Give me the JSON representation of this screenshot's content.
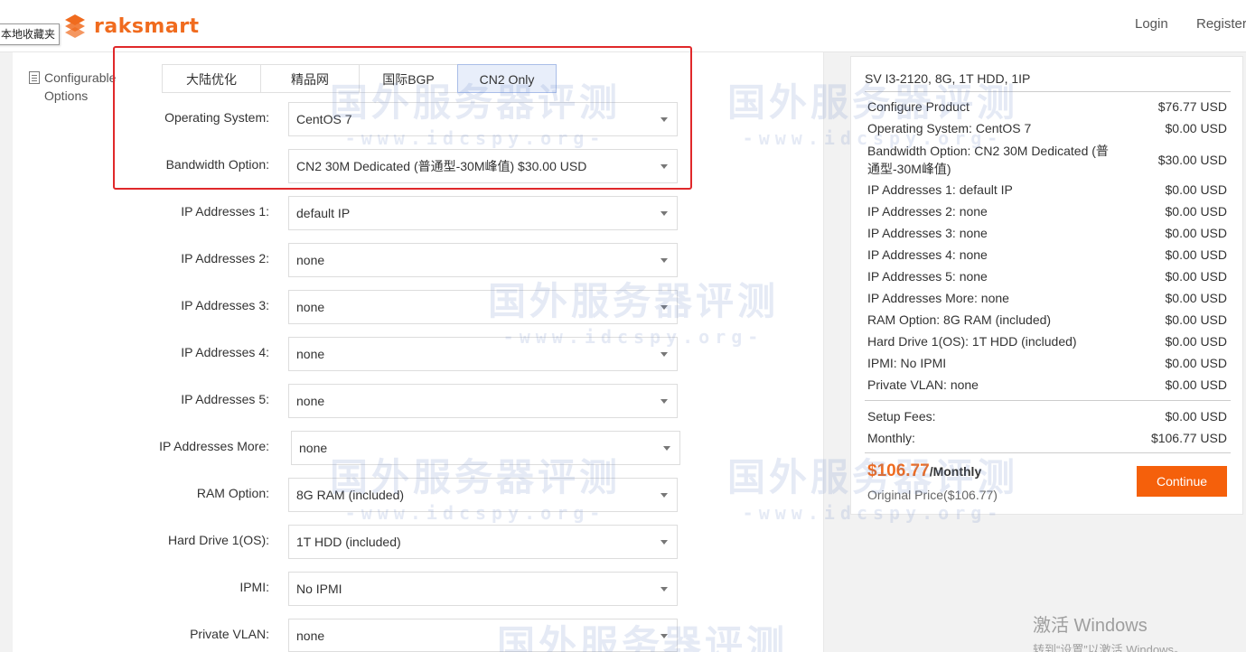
{
  "browser": {
    "bookmark_label": "本地收藏夹"
  },
  "header": {
    "logo_text": "raksmart",
    "login_label": "Login",
    "register_label": "Register",
    "brand_color": "#f06b1e"
  },
  "sidebar": {
    "title_line1": "Configurable",
    "title_line2": "Options"
  },
  "tabs": [
    {
      "label": "大陆优化",
      "active": false
    },
    {
      "label": "精品网",
      "active": false
    },
    {
      "label": "国际BGP",
      "active": false
    },
    {
      "label": "CN2 Only",
      "active": true
    }
  ],
  "form": [
    {
      "label": "Operating System:",
      "value": "CentOS 7"
    },
    {
      "label": "Bandwidth Option:",
      "value": "CN2 30M Dedicated (普通型-30M峰值) $30.00 USD"
    },
    {
      "label": "IP Addresses 1:",
      "value": "default IP"
    },
    {
      "label": "IP Addresses 2:",
      "value": "none"
    },
    {
      "label": "IP Addresses 3:",
      "value": "none"
    },
    {
      "label": "IP Addresses 4:",
      "value": "none"
    },
    {
      "label": "IP Addresses 5:",
      "value": "none"
    },
    {
      "label": "IP Addresses More:",
      "value": "none"
    },
    {
      "label": "RAM Option:",
      "value": "8G RAM (included)"
    },
    {
      "label": "Hard Drive 1(OS):",
      "value": "1T HDD (included)"
    },
    {
      "label": "IPMI:",
      "value": "No IPMI"
    },
    {
      "label": "Private VLAN:",
      "value": "none"
    }
  ],
  "summary": {
    "title": "SV I3-2120, 8G, 1T HDD, 1IP",
    "items": [
      {
        "name": "Configure Product",
        "price": "$76.77 USD"
      },
      {
        "name": "Operating System: CentOS 7",
        "price": "$0.00 USD"
      },
      {
        "name": "Bandwidth Option: CN2 30M Dedicated (普通型-30M峰值)",
        "price": "$30.00 USD"
      },
      {
        "name": "IP Addresses 1: default IP",
        "price": "$0.00 USD"
      },
      {
        "name": "IP Addresses 2: none",
        "price": "$0.00 USD"
      },
      {
        "name": "IP Addresses 3: none",
        "price": "$0.00 USD"
      },
      {
        "name": "IP Addresses 4: none",
        "price": "$0.00 USD"
      },
      {
        "name": "IP Addresses 5: none",
        "price": "$0.00 USD"
      },
      {
        "name": "IP Addresses More: none",
        "price": "$0.00 USD"
      },
      {
        "name": "RAM Option: 8G RAM (included)",
        "price": "$0.00 USD"
      },
      {
        "name": "Hard Drive 1(OS): 1T HDD (included)",
        "price": "$0.00 USD"
      },
      {
        "name": "IPMI: No IPMI",
        "price": "$0.00 USD"
      },
      {
        "name": "Private VLAN: none",
        "price": "$0.00 USD"
      }
    ],
    "setup_label": "Setup Fees:",
    "setup_price": "$0.00 USD",
    "monthly_label": "Monthly:",
    "monthly_price": "$106.77 USD",
    "total_price": "$106.77",
    "total_period": "/Monthly",
    "original_price": "Original Price($106.77)",
    "continue_label": "Continue",
    "continue_color": "#f5600b"
  },
  "watermark": {
    "big": "国外服务器评测",
    "small": "-www.idcspy.org-"
  },
  "windows_activation": {
    "line1": "激活 Windows",
    "line2": "转到“设置”以激活 Windows。"
  }
}
